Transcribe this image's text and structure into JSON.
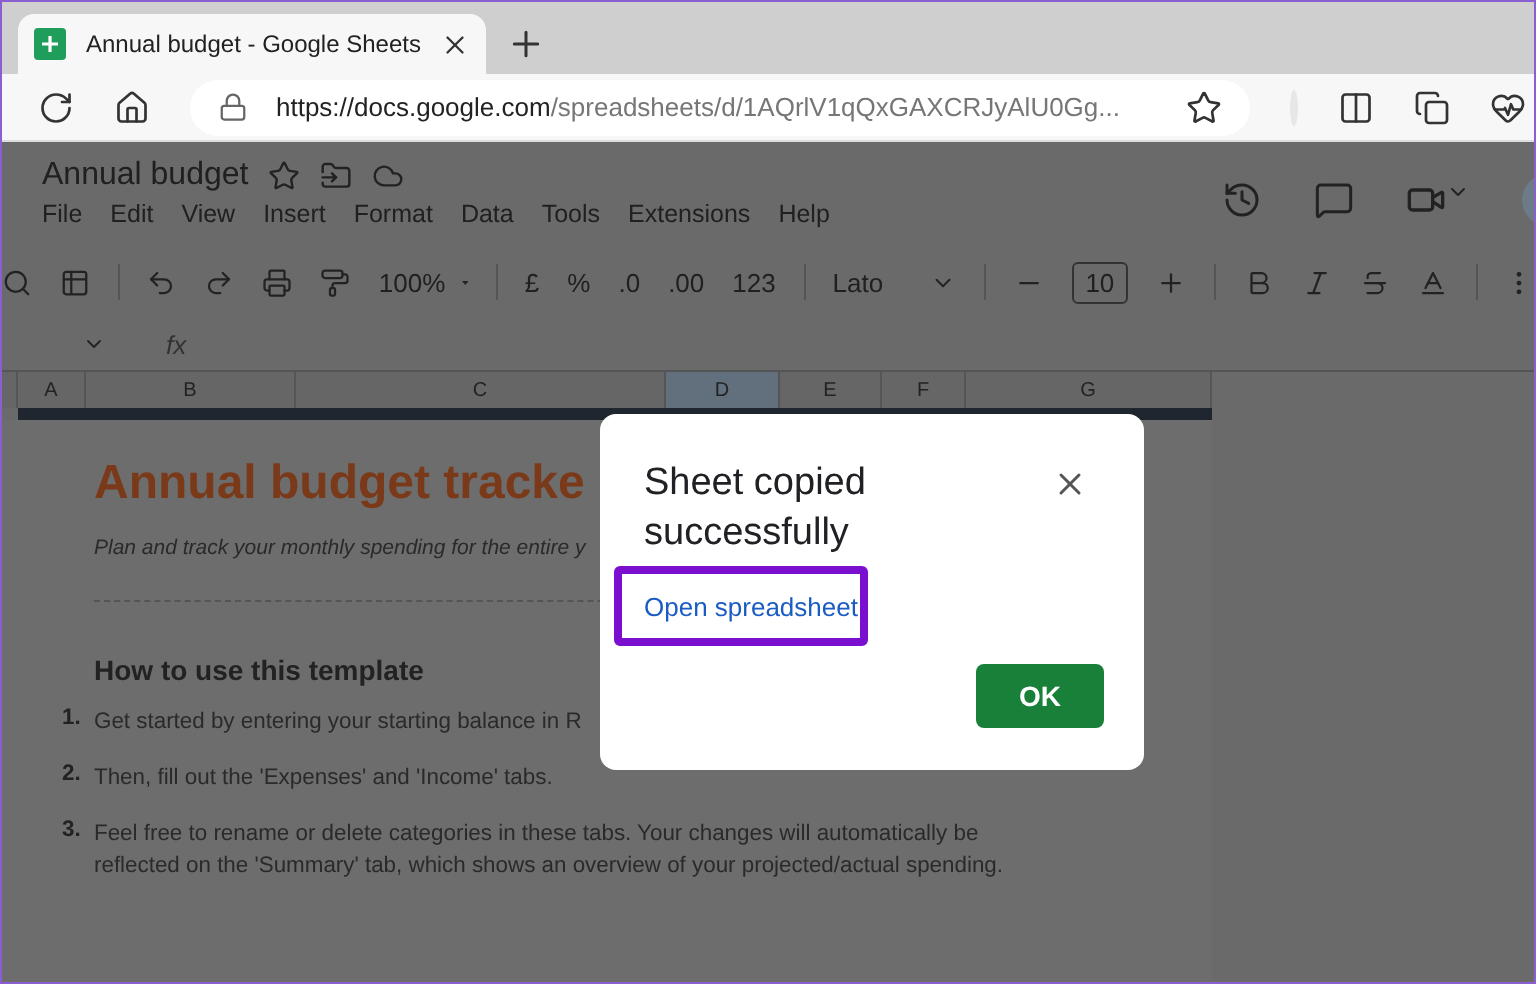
{
  "browser": {
    "tab_title": "Annual budget - Google Sheets",
    "url_host": "https://docs.google.com",
    "url_path": "/spreadsheets/d/1AQrlV1qQxGAXCRJyAlU0Gg..."
  },
  "sheet": {
    "title": "Annual budget",
    "menu": [
      "File",
      "Edit",
      "View",
      "Insert",
      "Format",
      "Data",
      "Tools",
      "Extensions",
      "Help"
    ],
    "toolbar": {
      "zoom": "100%",
      "currency": "£",
      "percent": "%",
      "decrease_decimal": ".0",
      "increase_decimal": ".00",
      "number_format": "123",
      "font": "Lato",
      "font_size": "10"
    },
    "formula_label": "fx",
    "columns": [
      {
        "label": "A",
        "selected": false
      },
      {
        "label": "B",
        "selected": false
      },
      {
        "label": "C",
        "selected": false
      },
      {
        "label": "D",
        "selected": true
      },
      {
        "label": "E",
        "selected": false
      },
      {
        "label": "F",
        "selected": false
      },
      {
        "label": "G",
        "selected": false
      }
    ],
    "content": {
      "title": "Annual budget tracke",
      "subtitle": "Plan and track your monthly spending for the entire y",
      "heading": "How to use this template",
      "steps": [
        {
          "number": "1.",
          "text": "Get started by entering your starting balance in R"
        },
        {
          "number": "2.",
          "text": "Then, fill out the 'Expenses' and 'Income' tabs."
        },
        {
          "number": "3.",
          "text": "Feel free to rename or delete categories in these tabs. Your changes will automatically be reflected on the 'Summary' tab, which shows an overview of your projected/actual spending."
        }
      ]
    }
  },
  "dialog": {
    "title": "Sheet copied successfully",
    "link": "Open spreadsheet",
    "button": "OK"
  }
}
